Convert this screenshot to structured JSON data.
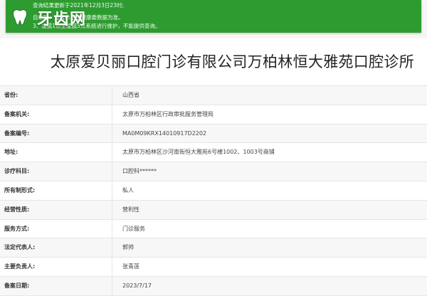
{
  "brand": {
    "name": "牙齿网",
    "logo_icon": "tooth-icon",
    "accent_color": "#2e9b31"
  },
  "notice": {
    "line1": "查询结果更新于2021年12月3日23时;",
    "line2": "自治区、直辖市卫生健康委数据为准。",
    "line3": "3、凌晨1点至凌晨5点系统进行维护，不能提供查询。"
  },
  "page_title": "太原爱贝丽口腔门诊有限公司万柏林恒大雅苑口腔诊所",
  "rows": [
    {
      "label": "省份:",
      "value": "山西省"
    },
    {
      "label": "备案机关:",
      "value": "太原市万柏林区行政审批服务管理局"
    },
    {
      "label": "备案编号:",
      "value": "MA0M09KRX14010917D2202"
    },
    {
      "label": "地址:",
      "value": "太原市万柏林区沙河南街恒大雅苑6号楼1002、1003号商铺"
    },
    {
      "label": "诊疗科目:",
      "value": "口腔科******"
    },
    {
      "label": "所有制形式:",
      "value": "私人"
    },
    {
      "label": "经营性质:",
      "value": "营利性"
    },
    {
      "label": "服务方式:",
      "value": "门诊服务"
    },
    {
      "label": "法定代表人:",
      "value": "郭帅"
    },
    {
      "label": "主要负责人:",
      "value": "张青莲"
    },
    {
      "label": "备案日期:",
      "value": "2023/7/17"
    }
  ]
}
